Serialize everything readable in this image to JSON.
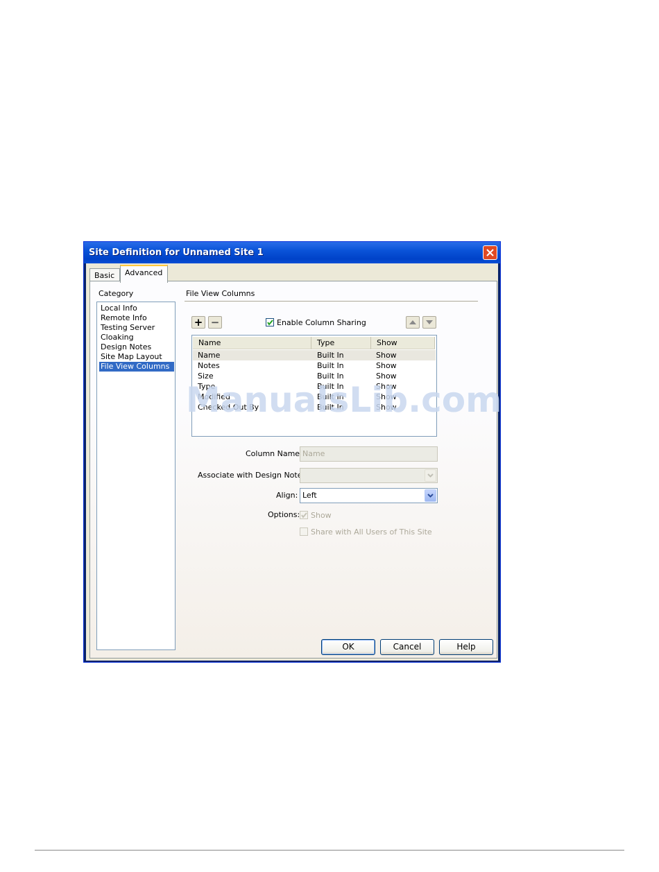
{
  "dialog": {
    "title": "Site Definition for Unnamed Site 1",
    "tabs": [
      "Basic",
      "Advanced"
    ],
    "active_tab": "Advanced",
    "category_label": "Category",
    "categories": [
      "Local Info",
      "Remote Info",
      "Testing Server",
      "Cloaking",
      "Design Notes",
      "Site Map Layout",
      "File View Columns"
    ],
    "selected_category": "File View Columns",
    "section_title": "File View Columns",
    "toolbar": {
      "add": "+",
      "remove": "−",
      "enable_sharing_label": "Enable Column Sharing",
      "enable_sharing_checked": true
    },
    "columns_table": {
      "headers": [
        "Name",
        "Type",
        "Show"
      ],
      "rows": [
        [
          "Name",
          "Built In",
          "Show"
        ],
        [
          "Notes",
          "Built In",
          "Show"
        ],
        [
          "Size",
          "Built In",
          "Show"
        ],
        [
          "Type",
          "Built In",
          "Show"
        ],
        [
          "Modified",
          "Built In",
          "Show"
        ],
        [
          "Checked Out By",
          "Built In",
          "Show"
        ]
      ]
    },
    "form": {
      "column_name_label": "Column Name:",
      "column_name_value": "Name",
      "design_note_label": "Associate with Design Note:",
      "design_note_value": "",
      "align_label": "Align:",
      "align_value": "Left",
      "options_label": "Options:",
      "show_label": "Show",
      "share_label": "Share with All Users of This Site"
    },
    "buttons": {
      "ok": "OK",
      "cancel": "Cancel",
      "help": "Help"
    }
  },
  "watermark": "ManualsLib.com",
  "colors": {
    "title_bar": "#0a53d8",
    "close": "#e04a24",
    "selection": "#316ac5"
  }
}
